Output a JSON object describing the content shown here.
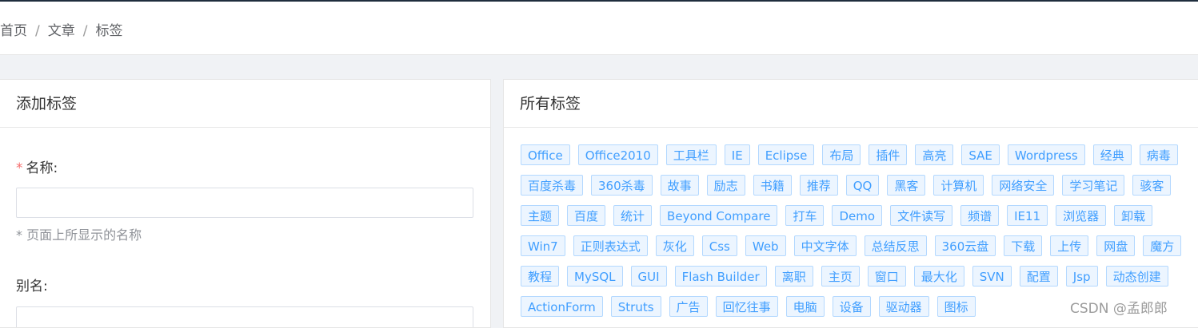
{
  "breadcrumb": {
    "home": "首页",
    "articles": "文章",
    "tags": "标签"
  },
  "add_panel": {
    "title": "添加标签",
    "name_label": "名称:",
    "name_hint": "* 页面上所显示的名称",
    "alias_label": "别名:"
  },
  "all_panel": {
    "title": "所有标签",
    "tags": [
      "Office",
      "Office2010",
      "工具栏",
      "IE",
      "Eclipse",
      "布局",
      "插件",
      "高亮",
      "SAE",
      "Wordpress",
      "经典",
      "病毒",
      "百度杀毒",
      "360杀毒",
      "故事",
      "励志",
      "书籍",
      "推荐",
      "QQ",
      "黑客",
      "计算机",
      "网络安全",
      "学习笔记",
      "骇客",
      "主题",
      "百度",
      "统计",
      "Beyond Compare",
      "打车",
      "Demo",
      "文件读写",
      "频谱",
      "IE11",
      "浏览器",
      "卸载",
      "Win7",
      "正则表达式",
      "灰化",
      "Css",
      "Web",
      "中文字体",
      "总结反思",
      "360云盘",
      "下载",
      "上传",
      "网盘",
      "魔方",
      "教程",
      "MySQL",
      "GUI",
      "Flash Builder",
      "离职",
      "主页",
      "窗口",
      "最大化",
      "SVN",
      "配置",
      "Jsp",
      "动态创建",
      "ActionForm",
      "Struts",
      "广告",
      "回忆往事",
      "电脑",
      "设备",
      "驱动器",
      "图标"
    ]
  },
  "watermark": "CSDN @孟郎郎",
  "colors": {
    "tag_text": "#409eff",
    "tag_bg": "#ecf5ff",
    "tag_border": "#b3d8ff",
    "required": "#f56c6c"
  }
}
